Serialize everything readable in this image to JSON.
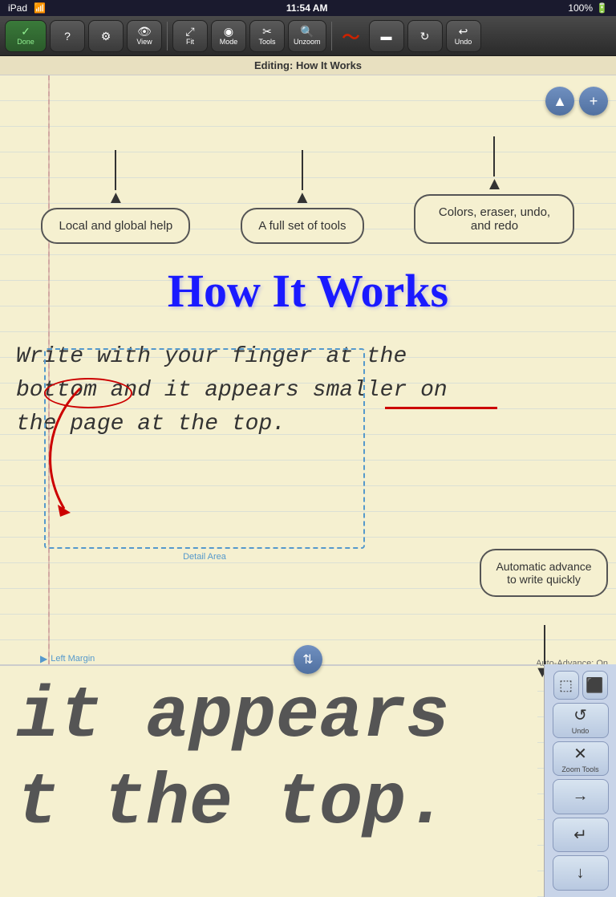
{
  "status": {
    "device": "iPad",
    "wifi": "WiFi",
    "time": "11:54 AM",
    "battery": "100%"
  },
  "title_bar": {
    "text": "Editing: How It Works"
  },
  "toolbar": {
    "done_label": "Done",
    "help_label": "?",
    "settings_icon": "⚙",
    "view_label": "View",
    "fit_label": "Fit",
    "mode_label": "Mode",
    "tools_label": "Tools",
    "unzoom_label": "Unzoom",
    "record_label": "●",
    "erase_label": "▬",
    "refresh_label": "↻",
    "undo_label": "Undo"
  },
  "info_boxes": [
    {
      "id": "help-box",
      "text": "Local and global help"
    },
    {
      "id": "tools-box",
      "text": "A full set of tools"
    },
    {
      "id": "colors-box",
      "text": "Colors, eraser, undo, and redo"
    }
  ],
  "page": {
    "title": "How It Works",
    "handwritten_line1": "Write with your finger at the",
    "handwritten_line2": "bottom and it appears smaller on",
    "handwritten_line3": "the page at the top.",
    "detail_area_label": "Detail Area",
    "left_margin_label": "Left Margin",
    "auto_advance_label": "Auto-Advance: On",
    "auto_advance_bubble": "Automatic advance to write quickly"
  },
  "bottom_writing": {
    "line1": "it appears",
    "line2": "t the top."
  },
  "right_panel": {
    "select_btn": "⬚",
    "select_label": "",
    "undo_icon": "↺",
    "undo_label": "Undo",
    "zoom_icon": "✕",
    "zoom_label": "Zoom Tools",
    "advance_icon": "→",
    "enter_icon": "↵",
    "down_icon": "↓"
  },
  "float_btns": {
    "up_icon": "▲",
    "plus_icon": "+"
  }
}
